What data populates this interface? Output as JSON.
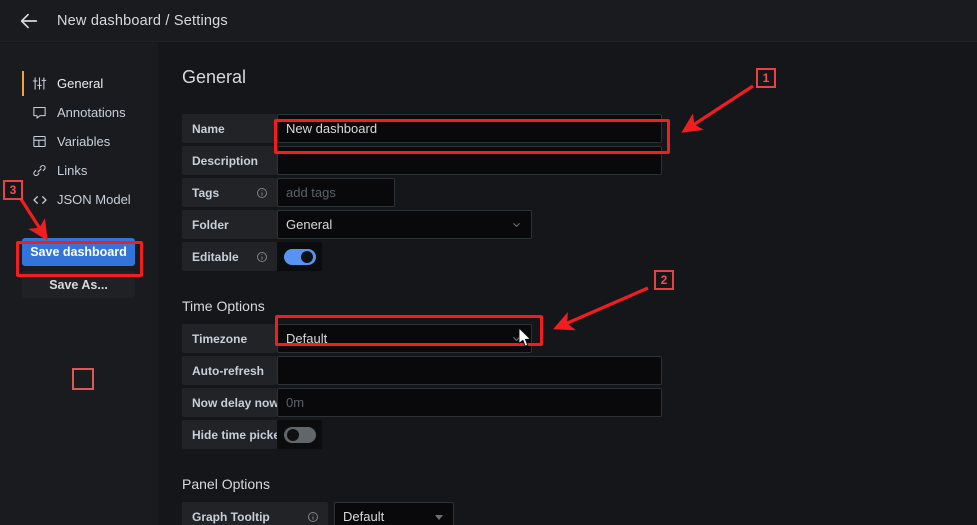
{
  "topbar": {
    "back_icon": "arrow-left-icon",
    "title": "New dashboard / Settings"
  },
  "sidebar": {
    "items": [
      {
        "label": "General",
        "icon": "sliders-icon",
        "active": true
      },
      {
        "label": "Annotations",
        "icon": "comment-icon",
        "active": false
      },
      {
        "label": "Variables",
        "icon": "table-icon",
        "active": false
      },
      {
        "label": "Links",
        "icon": "link-icon",
        "active": false
      },
      {
        "label": "JSON Model",
        "icon": "code-icon",
        "active": false
      }
    ],
    "save_dashboard_label": "Save dashboard",
    "save_as_label": "Save As..."
  },
  "main": {
    "section_title": "General",
    "general_fields": {
      "name_label": "Name",
      "name_value": "New dashboard",
      "description_label": "Description",
      "description_value": "",
      "description_placeholder": "",
      "tags_label": "Tags",
      "tags_value": "",
      "tags_placeholder": "add tags",
      "folder_label": "Folder",
      "folder_value": "General",
      "editable_label": "Editable",
      "editable_on": true
    },
    "time_options": {
      "title": "Time Options",
      "timezone_label": "Timezone",
      "timezone_value": "Default",
      "auto_refresh_label": "Auto-refresh",
      "auto_refresh_value": "",
      "auto_refresh_placeholder": "",
      "now_delay_label": "Now delay now-",
      "now_delay_value": "",
      "now_delay_placeholder": "0m",
      "hide_time_picker_label": "Hide time picker",
      "hide_time_picker_on": false
    },
    "panel_options": {
      "title": "Panel Options",
      "graph_tooltip_label": "Graph Tooltip",
      "graph_tooltip_value": "Default"
    }
  },
  "annotations": {
    "badge_1": "1",
    "badge_2": "2",
    "badge_3": "3",
    "highlight_color": "#f01e20",
    "badge_text_color": "#f2504e"
  }
}
